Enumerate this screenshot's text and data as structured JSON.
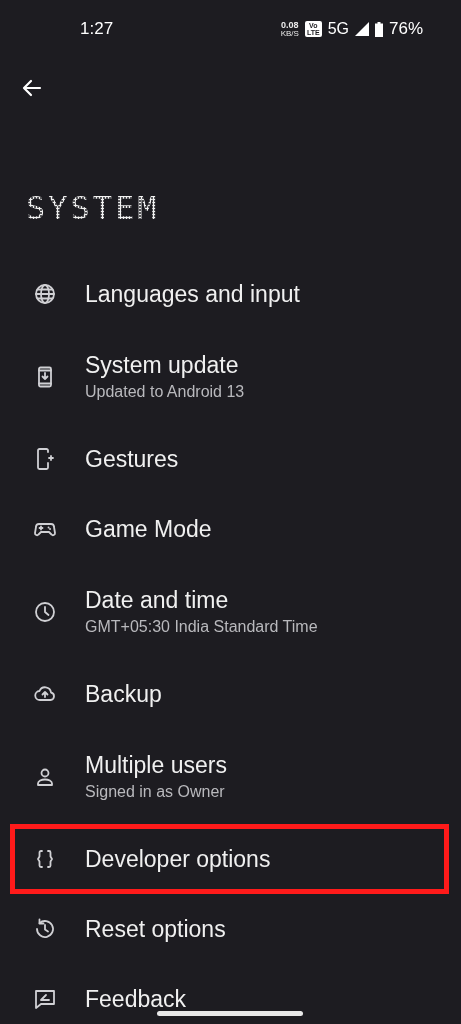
{
  "status_bar": {
    "time": "1:27",
    "speed": "0.08",
    "speed_unit": "KB/S",
    "volte_top": "Vo",
    "volte_bottom": "LTE",
    "network": "5G",
    "battery": "76%"
  },
  "title": "SYSTEM",
  "items": [
    {
      "kind": "globe",
      "title": "Languages and input",
      "highlighted": false
    },
    {
      "kind": "update",
      "title": "System update",
      "subtitle": "Updated to Android 13",
      "highlighted": false
    },
    {
      "kind": "gestures",
      "title": "Gestures",
      "highlighted": false
    },
    {
      "kind": "game",
      "title": "Game Mode",
      "highlighted": false
    },
    {
      "kind": "clock",
      "title": "Date and time",
      "subtitle": "GMT+05:30 India Standard Time",
      "highlighted": false
    },
    {
      "kind": "backup",
      "title": "Backup",
      "highlighted": false
    },
    {
      "kind": "user",
      "title": "Multiple users",
      "subtitle": "Signed in as Owner",
      "highlighted": false
    },
    {
      "kind": "braces",
      "title": "Developer options",
      "highlighted": true
    },
    {
      "kind": "reset",
      "title": "Reset options",
      "highlighted": false
    },
    {
      "kind": "feedback",
      "title": "Feedback",
      "highlighted": false
    }
  ]
}
